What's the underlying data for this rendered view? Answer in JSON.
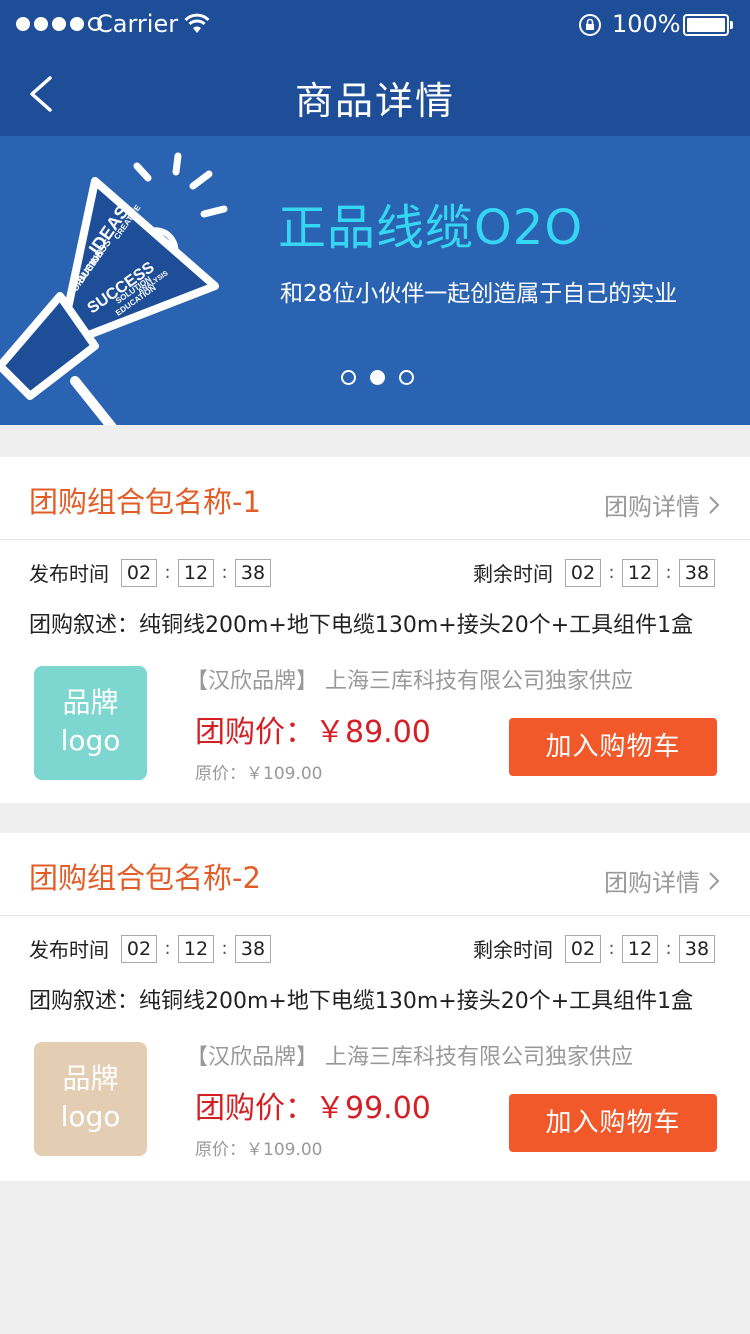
{
  "status_bar": {
    "carrier": "Carrier",
    "battery": "100%"
  },
  "nav": {
    "title": "商品详情"
  },
  "banner": {
    "title": "正品线缆O2O",
    "subtitle": "和28位小伙伴一起创造属于自己的实业",
    "art_words": [
      "IDEAS",
      "CREATIVE",
      "BUSINESS",
      "INFORMATION",
      "SUCCESS",
      "SOLUTION",
      "EDUCATION",
      "ANALYSIS"
    ],
    "page_count": 3,
    "active_page": 2
  },
  "colors": {
    "header": "#1e4e97",
    "banner": "#2b63b3",
    "accent_orange": "#e35d27",
    "price_red": "#d41f25",
    "cart_button": "#f1582a",
    "logo_teal": "#7dd6cf",
    "logo_beige": "#e3cdb3"
  },
  "cards": [
    {
      "title": "团购组合包名称-1",
      "detail_link": "团购详情",
      "publish_label": "发布时间",
      "publish_time": [
        "02",
        "12",
        "38"
      ],
      "remaining_label": "剩余时间",
      "remaining_time": [
        "02",
        "12",
        "38"
      ],
      "description": "团购叙述：纯铜线200m+地下电缆130m+接头20个+工具组件1盒",
      "logo_line1": "品牌",
      "logo_line2": "logo",
      "brand": "【汉欣品牌】 上海三库科技有限公司独家供应",
      "price": "团购价：￥89.00",
      "original_price": "原价：￥109.00",
      "cart_button": "加入购物车"
    },
    {
      "title": "团购组合包名称-2",
      "detail_link": "团购详情",
      "publish_label": "发布时间",
      "publish_time": [
        "02",
        "12",
        "38"
      ],
      "remaining_label": "剩余时间",
      "remaining_time": [
        "02",
        "12",
        "38"
      ],
      "description": "团购叙述：纯铜线200m+地下电缆130m+接头20个+工具组件1盒",
      "logo_line1": "品牌",
      "logo_line2": "logo",
      "brand": "【汉欣品牌】 上海三库科技有限公司独家供应",
      "price": "团购价：￥99.00",
      "original_price": "原价：￥109.00",
      "cart_button": "加入购物车"
    }
  ]
}
